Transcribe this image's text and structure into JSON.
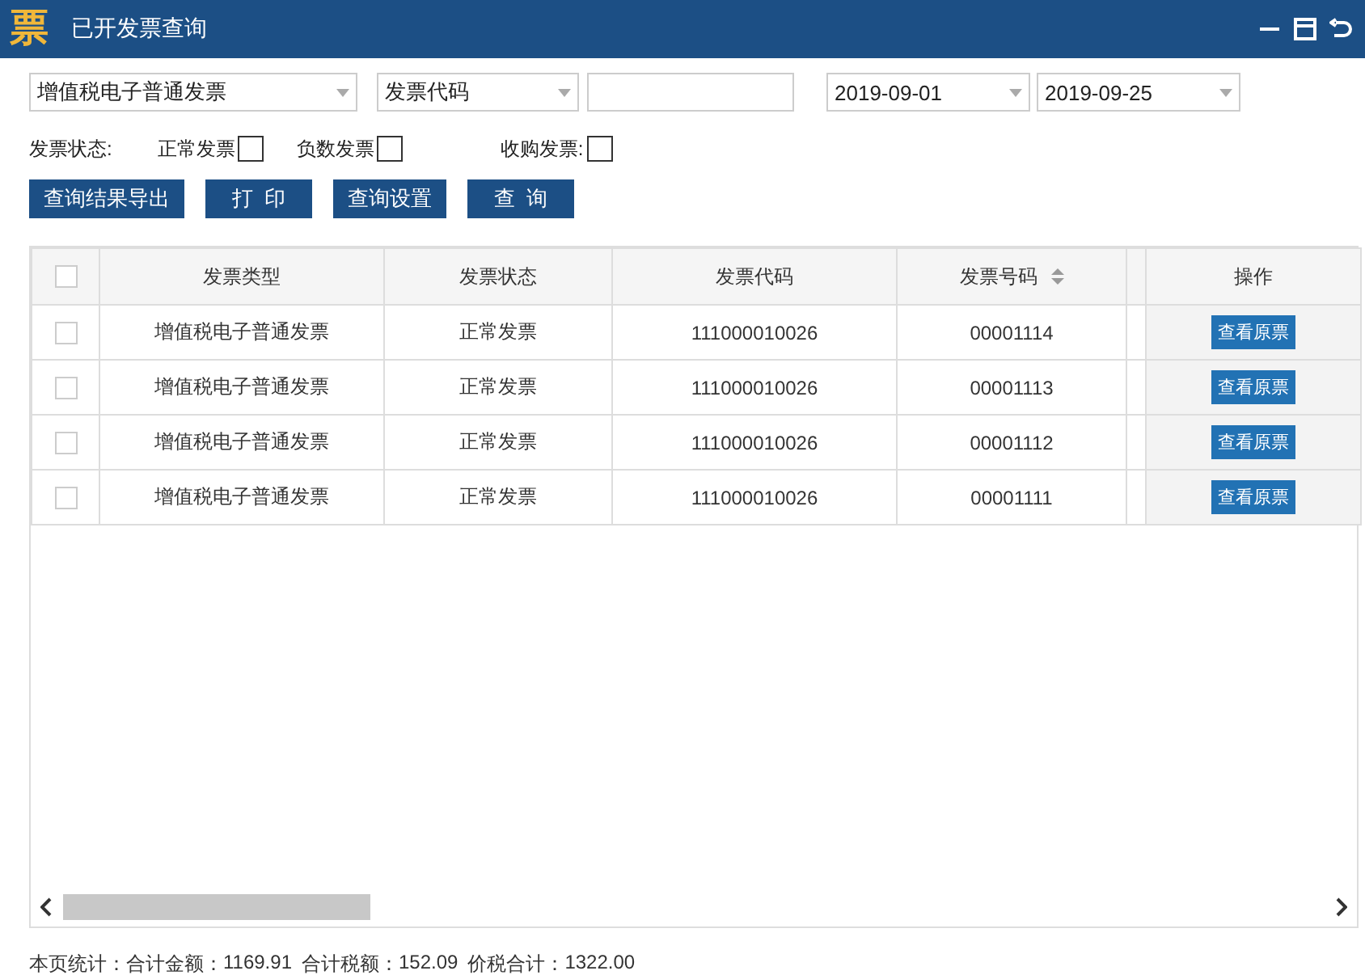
{
  "window": {
    "logo": "票",
    "title": "已开发票查询"
  },
  "filters": {
    "invoice_type": "增值税电子普通发票",
    "query_field": "发票代码",
    "date_from": "2019-09-01",
    "date_to": "2019-09-25"
  },
  "status_filter": {
    "label": "发票状态:",
    "options": [
      {
        "label": "正常发票",
        "checked": false
      },
      {
        "label": "负数发票",
        "checked": false
      },
      {
        "label": "收购发票:",
        "checked": false
      }
    ]
  },
  "buttons": [
    "查询结果导出",
    "打  印",
    "查询设置",
    "查  询"
  ],
  "table": {
    "header_checked": false,
    "columns": [
      {
        "label": "发票类型",
        "sortable": false
      },
      {
        "label": "发票状态",
        "sortable": false
      },
      {
        "label": "发票代码",
        "sortable": false
      },
      {
        "label": "发票号码",
        "sortable": true
      },
      {
        "label": "操作",
        "sortable": false
      }
    ],
    "rows": [
      {
        "checked": false,
        "cells": [
          "增值税电子普通发票",
          "正常发票",
          "111000010026",
          "00001114"
        ],
        "action": "查看原票"
      },
      {
        "checked": false,
        "cells": [
          "增值税电子普通发票",
          "正常发票",
          "111000010026",
          "00001113"
        ],
        "action": "查看原票"
      },
      {
        "checked": false,
        "cells": [
          "增值税电子普通发票",
          "正常发票",
          "111000010026",
          "00001112"
        ],
        "action": "查看原票"
      },
      {
        "checked": false,
        "cells": [
          "增值税电子普通发票",
          "正常发票",
          "111000010026",
          "00001111"
        ],
        "action": "查看原票"
      }
    ]
  },
  "footer": [
    "本页统计：",
    "合计金额：",
    "1169.91",
    "合计税额：",
    "152.09",
    "价税合计：",
    "1322.00"
  ]
}
